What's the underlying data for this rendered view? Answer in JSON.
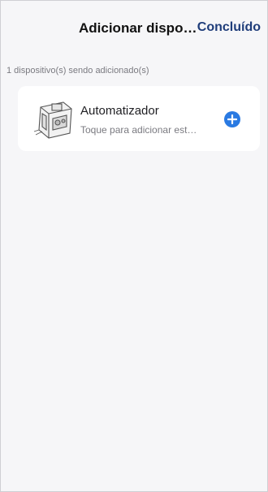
{
  "header": {
    "title": "Adicionar dispositivo",
    "done_label": "Concluído"
  },
  "status": {
    "count_text": "1 dispositivo(s) sendo adicionado(s)"
  },
  "devices": [
    {
      "name": "Automatizador",
      "subtitle": "Toque para adicionar este dispositivo",
      "icon": "gate-motor-device-icon",
      "action_icon": "plus-circle-icon"
    }
  ],
  "colors": {
    "accent": "#2a7ae2",
    "done_text": "#1f3d7a",
    "background": "#f6f6f8"
  }
}
